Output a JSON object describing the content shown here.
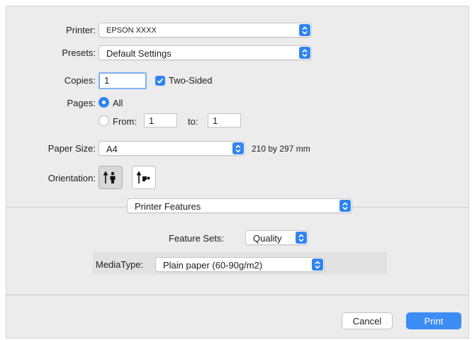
{
  "printer": {
    "label": "Printer:",
    "value": "EPSON XXXX"
  },
  "presets": {
    "label": "Presets:",
    "value": "Default Settings"
  },
  "copies": {
    "label": "Copies:",
    "value": "1",
    "two_sided_label": "Two-Sided",
    "two_sided_checked": true
  },
  "pages": {
    "label": "Pages:",
    "all_label": "All",
    "from_label": "From:",
    "from_value": "1",
    "to_label": "to:",
    "to_value": "1",
    "selected": "all"
  },
  "paper_size": {
    "label": "Paper Size:",
    "value": "A4",
    "dimensions": "210 by 297 mm"
  },
  "orientation": {
    "label": "Orientation:",
    "selected": "portrait",
    "icons": [
      "portrait-orientation-icon",
      "landscape-orientation-icon"
    ]
  },
  "section": {
    "value": "Printer Features"
  },
  "feature_sets": {
    "label": "Feature Sets:",
    "value": "Quality"
  },
  "media_type": {
    "label": "MediaType:",
    "value": "Plain paper (60-90g/m2)"
  },
  "buttons": {
    "cancel": "Cancel",
    "print": "Print"
  },
  "colors": {
    "accent": "#2f84f0",
    "dialog_bg": "#ececec"
  }
}
